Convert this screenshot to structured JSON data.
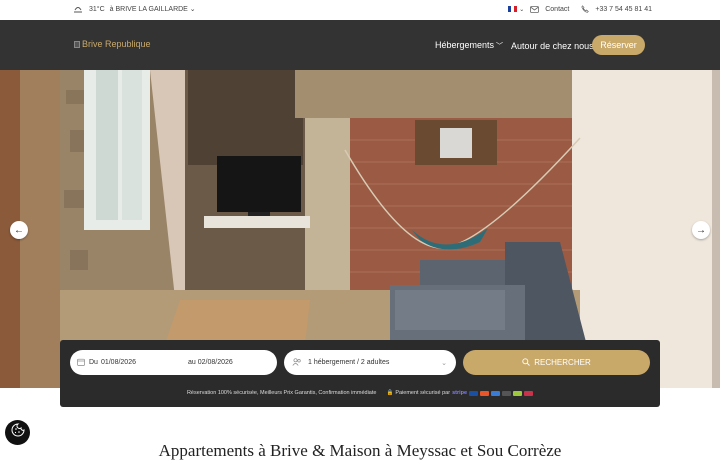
{
  "topbar": {
    "weather_icon": "cloud-sun-icon",
    "temperature": "31°C",
    "location": "à BRIVE LA GAILLARDE",
    "language_flag": "fr-flag-icon",
    "contact_label": "Contact",
    "phone": "+33 7 54 45 81 41"
  },
  "header": {
    "logo_alt": "Brive Republique",
    "nav": [
      {
        "label": "Hébergements",
        "has_dropdown": true
      },
      {
        "label": "Autour de chez nous",
        "has_dropdown": false
      }
    ],
    "reserve_label": "Réserver"
  },
  "hero": {
    "prev_icon": "arrow-left-icon",
    "next_icon": "arrow-right-icon"
  },
  "booking": {
    "from_label": "Du",
    "from_date": "01/08/2026",
    "to_label": "au",
    "to_date": "02/08/2026",
    "guests": "1 hébergement / 2 adultes",
    "search_label": "RECHERCHER",
    "trust_text": "Réservation 100% sécurisée, Meilleurs Prix Garantis, Confirmation immédiate",
    "payment_text": "Paiement sécurisé par",
    "payment_provider": "stripe"
  },
  "main": {
    "heading": "Appartements à Brive & Maison à Meyssac et Sou Corrèze"
  },
  "colors": {
    "accent": "#c9a96a",
    "header_bg": "#333333",
    "booking_bg": "#2b2b2b"
  }
}
